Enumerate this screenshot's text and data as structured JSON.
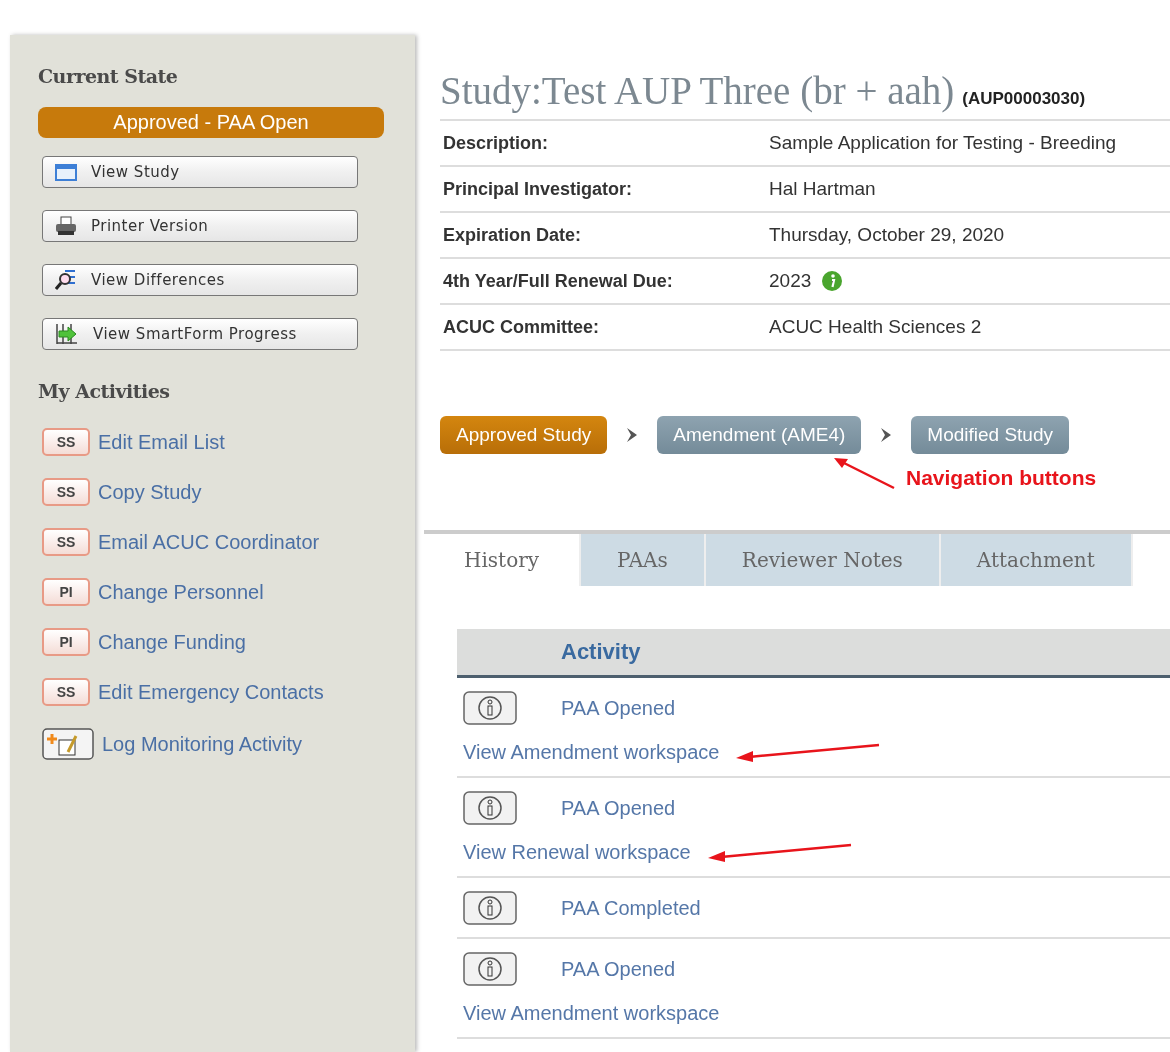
{
  "sidebar": {
    "state_heading": "Current State",
    "state": "Approved - PAA Open",
    "buttons": [
      {
        "label": "View Study",
        "kind": "window"
      },
      {
        "label": "Printer Version",
        "kind": "printer"
      },
      {
        "label": "View Differences",
        "kind": "differences"
      },
      {
        "label": "View SmartForm Progress",
        "kind": "progress"
      }
    ],
    "activities_heading": "My Activities",
    "activities": [
      {
        "kind": "badge",
        "badge": "SS",
        "label": "Edit Email List"
      },
      {
        "kind": "badge",
        "badge": "SS",
        "label": "Copy Study"
      },
      {
        "kind": "badge",
        "badge": "SS",
        "label": "Email ACUC Coordinator"
      },
      {
        "kind": "badge",
        "badge": "PI",
        "label": "Change Personnel"
      },
      {
        "kind": "badge",
        "badge": "PI",
        "label": "Change Funding"
      },
      {
        "kind": "badge",
        "badge": "SS",
        "label": "Edit Emergency Contacts"
      },
      {
        "kind": "log",
        "label": "Log Monitoring Activity"
      }
    ]
  },
  "study": {
    "title": "Study:Test AUP Three (br + aah)",
    "id": "(AUP00003030)",
    "fields": [
      {
        "label": "Description:",
        "value": "Sample Application for Testing - Breeding",
        "info": false
      },
      {
        "label": "Principal Investigator:",
        "value": "Hal Hartman",
        "info": false
      },
      {
        "label": "Expiration Date:",
        "value": "Thursday, October 29, 2020",
        "info": false
      },
      {
        "label": "4th Year/Full Renewal Due:",
        "value": "2023",
        "info": true
      },
      {
        "label": "ACUC Committee:",
        "value": "ACUC Health Sciences 2",
        "info": false
      }
    ]
  },
  "navigation": [
    {
      "label": "Approved Study",
      "selected": true
    },
    {
      "label": "Amendment (AME4)",
      "selected": false
    },
    {
      "label": "Modified Study",
      "selected": false
    }
  ],
  "annotation": "Navigation buttons",
  "tabs": [
    {
      "label": "History",
      "selected": true
    },
    {
      "label": "PAAs",
      "selected": false
    },
    {
      "label": "Reviewer Notes",
      "selected": false
    },
    {
      "label": "Attachment",
      "selected": false
    }
  ],
  "history": {
    "column": "Activity",
    "rows": [
      {
        "activity": "PAA Opened",
        "link": "View Amendment workspace",
        "arrow": true
      },
      {
        "activity": "PAA Opened",
        "link": "View Renewal workspace",
        "arrow": true
      },
      {
        "activity": "PAA Completed"
      },
      {
        "activity": "PAA Opened",
        "link": "View Amendment workspace",
        "arrow": false
      }
    ]
  }
}
